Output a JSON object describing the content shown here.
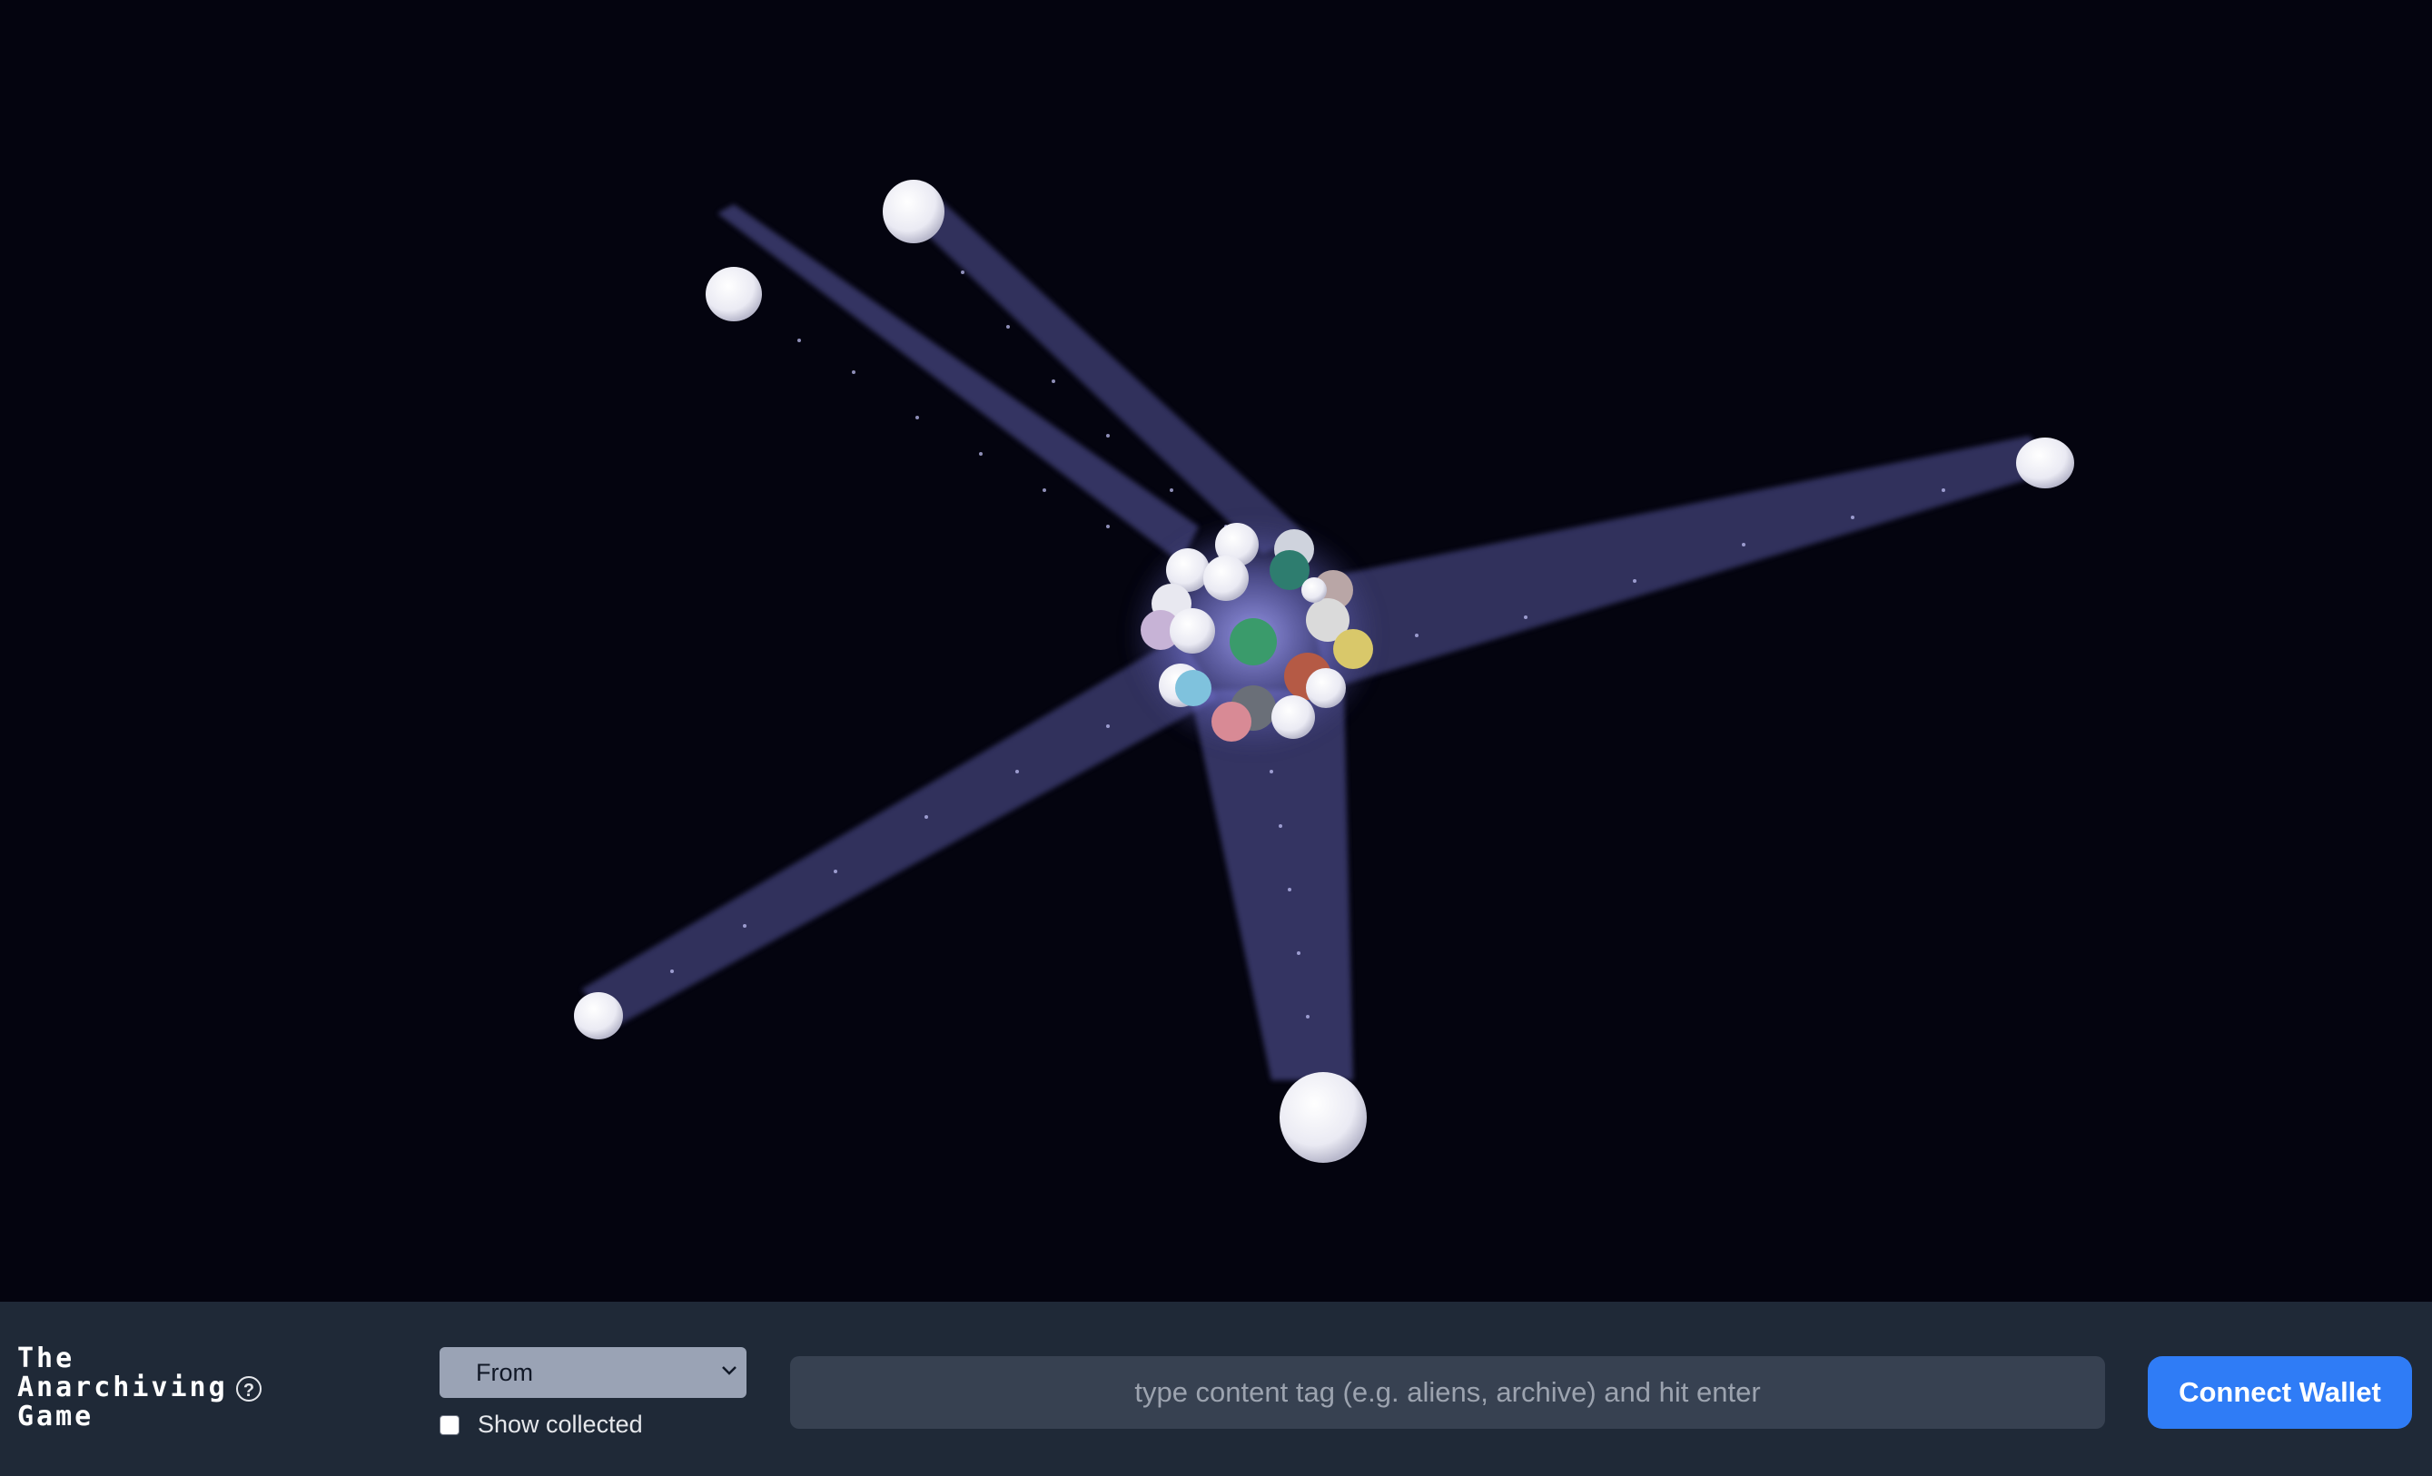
{
  "app": {
    "title_lines": [
      "The",
      "Anarchiving",
      "Game"
    ]
  },
  "controls": {
    "order_select": {
      "selected": "From"
    },
    "show_collected": {
      "label": "Show collected",
      "checked": false
    },
    "search": {
      "placeholder": "type content tag (e.g. aliens, archive) and hit enter"
    },
    "connect_label": "Connect Wallet"
  },
  "icons": {
    "help": "question-circle-icon",
    "select_arrow": "chevron-down-icon"
  },
  "colors": {
    "background": "#04040f",
    "bottom_bar": "#1f2937",
    "beam": "#6f6fc8",
    "accent": "#2f7cf6"
  }
}
